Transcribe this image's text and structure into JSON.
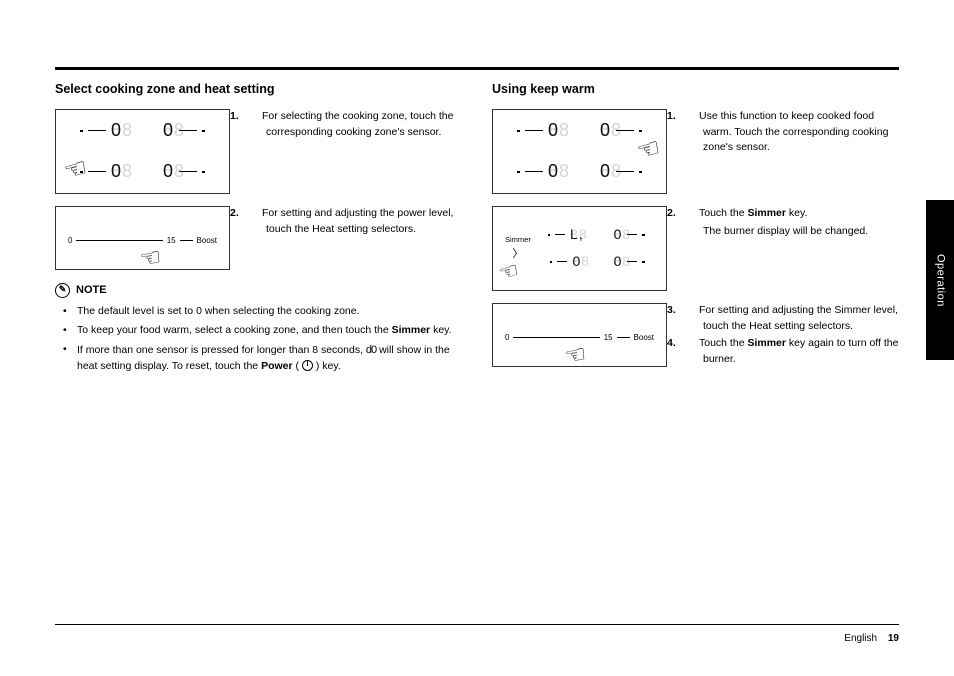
{
  "left": {
    "heading": "Select cooking zone and heat setting",
    "step1_num": "1.",
    "step1_text": "For selecting the cooking zone, touch the corresponding cooking zone's sensor.",
    "step2_num": "2.",
    "step2_text": "For setting and adjusting the power level, touch the Heat setting selectors.",
    "slider_min": "0",
    "slider_max": "15",
    "slider_boost": "Boost",
    "note_label": "NOTE",
    "notes": {
      "n0": "The default level is set to 0 when selecting the cooking zone.",
      "n1a": "To keep your food warm, select a cooking zone, and then touch the ",
      "n1b": "Simmer",
      "n1c": " key.",
      "n2a": "If more than one sensor is pressed for longer than 8 seconds, ",
      "n2b": " will show in the heat setting display. To reset, touch the ",
      "n2c": "Power",
      "n2d": " ( ",
      "n2e": " ) key."
    },
    "d0_glyph": "d0"
  },
  "right": {
    "heading": "Using keep warm",
    "step1_num": "1.",
    "step1_text": "Use this function to keep cooked food warm. Touch the corresponding cooking zone's sensor.",
    "step2_num": "2.",
    "step2_line1a": "Touch the ",
    "step2_line1b": "Simmer",
    "step2_line1c": " key.",
    "step2_line2": "The burner display will be changed.",
    "step3_num": "3.",
    "step3_text": "For setting and adjusting the Simmer level, touch the Heat setting selectors.",
    "step4_num": "4.",
    "step4a": "Touch the ",
    "step4b": "Simmer",
    "step4c": " key again to turn off the burner.",
    "simmer_label": "Simmer",
    "slider_min": "0",
    "slider_max": "15",
    "slider_boost": "Boost"
  },
  "display_digit": " 0",
  "pause_glyph": "L,",
  "sidebar": "Operation",
  "footer_lang": "English",
  "footer_page": "19"
}
